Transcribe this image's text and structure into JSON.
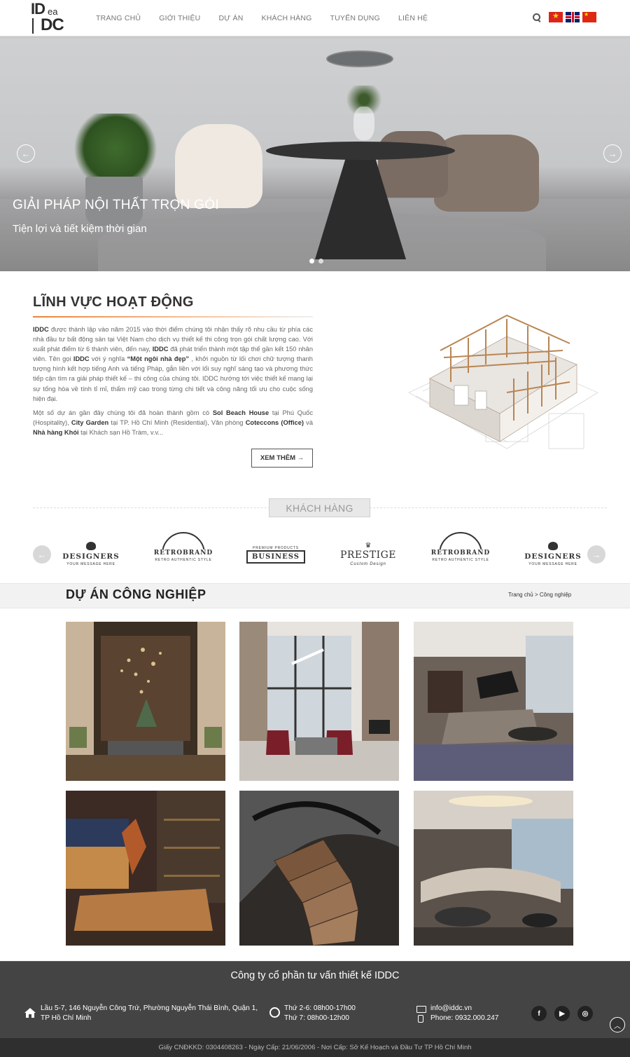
{
  "header": {
    "logo": {
      "line1": "ID",
      "line1_small": "ea",
      "line2": "DC"
    },
    "nav": [
      "TRANG CHỦ",
      "GIỚI THIỆU",
      "DỰ ÁN",
      "KHÁCH HÀNG",
      "TUYỂN DỤNG",
      "LIÊN HỆ"
    ],
    "icons": {
      "search": "search-icon"
    },
    "languages": [
      "vi",
      "en",
      "zh"
    ]
  },
  "hero": {
    "title": "GIẢI PHÁP NỘI THẤT TRỌN GÓI",
    "subtitle": "Tiện lợi và tiết kiệm thời gian",
    "slide_count": 2,
    "active_slide": 1
  },
  "field": {
    "title": "LĨNH VỰC HOẠT ĐỘNG",
    "p1": [
      {
        "t": "IDDC",
        "b": true
      },
      {
        "t": " được thành lập vào năm 2015 vào thời điểm chúng tôi nhận thấy rõ nhu cầu từ phía các nhà đầu tư bất động sản tại Việt Nam cho dịch vụ thiết kế thi công trọn gói chất lượng cao. Với xuất phát điểm từ 6 thành viên, đến nay, ",
        "b": false
      },
      {
        "t": "IDDC",
        "b": true
      },
      {
        "t": " đã phát triển thành một tập thể gần kết 150 nhân viên. Tên gọi ",
        "b": false
      },
      {
        "t": "IDDC",
        "b": true
      },
      {
        "t": " với ý nghĩa ",
        "b": false
      },
      {
        "t": "“Một ngôi nhà đẹp”",
        "b": true
      },
      {
        "t": " , khởi nguồn từ lối chơi chữ tượng thanh tượng hình kết hợp tiếng Anh và tiếng Pháp, gắn liền với lối suy nghĩ sáng tạo và phương thức tiếp cận tìm ra giải pháp thiết kế – thi công của chúng tôi. IDDC hướng tới việc thiết kế mang lại sự tổng hòa về tính tỉ mỉ, thẩm mỹ cao trong từng chi tiết và công năng tối ưu cho cuộc sống hiện đại.",
        "b": false
      }
    ],
    "p2": [
      {
        "t": "Một số dự án gần đây chúng tôi đã hoàn thành gồm có ",
        "b": false
      },
      {
        "t": "Sol Beach House",
        "b": true
      },
      {
        "t": " tại Phú Quốc (Hospitality), ",
        "b": false
      },
      {
        "t": "City Garden",
        "b": true
      },
      {
        "t": " tại TP. Hồ Chí Minh (Residential), Văn phòng ",
        "b": false
      },
      {
        "t": "Coteccons (Office)",
        "b": true
      },
      {
        "t": " và ",
        "b": false
      },
      {
        "t": "Nhà hàng Khói",
        "b": true
      },
      {
        "t": " tại Khách sạn Hồ Tràm, v.v...",
        "b": false
      }
    ],
    "more_label": "XEM THÊM →"
  },
  "customers": {
    "title": "KHÁCH HÀNG",
    "brands": [
      {
        "kind": "designers",
        "name": "DESIGNERS",
        "tag": "YOUR MESSAGE HERE"
      },
      {
        "kind": "retro",
        "name": "RETROBRAND",
        "tag": "RETRO AUTHENTIC STYLE"
      },
      {
        "kind": "business",
        "name": "BUSINESS",
        "tag": "PREMIUM PRODUCTS"
      },
      {
        "kind": "prestige",
        "name": "PRESTIGE",
        "tag": "Custom Design"
      },
      {
        "kind": "retro",
        "name": "RETROBRAND",
        "tag": "RETRO AUTHENTIC STYLE"
      },
      {
        "kind": "designers",
        "name": "DESIGNERS",
        "tag": "YOUR MESSAGE HERE"
      }
    ]
  },
  "projects": {
    "title": "DỰ ÁN CÔNG NGHIỆP",
    "breadcrumb": "Trang chủ > Công nghiệp",
    "images": [
      "lobby-chandelier",
      "living-room-window",
      "living-room-piano",
      "bedroom-sculpture",
      "spiral-staircase",
      "round-sofa-lounge"
    ]
  },
  "footer": {
    "company": "Công ty cổ phần tư vấn thiết kế IDDC",
    "address_line1": "Lầu 5-7, 146 Nguyễn Công Trứ, Phường Nguyễn Thái Bình, Quận 1,",
    "address_line2": "TP Hồ Chí Minh",
    "hours_line1": "Thứ 2-6: 08h00-17h00",
    "hours_line2": "Thứ 7: 08h00-12h00",
    "email": "info@iddc.vn",
    "phone": "Phone: 0932.000.247",
    "social": [
      "facebook-icon",
      "youtube-icon",
      "instagram-icon"
    ],
    "license": "Giấy CNĐKKD: 0304408263 - Ngày Cấp: 21/06/2006 - Nơi Cấp: Sở Kế Hoạch và Đầu Tư TP Hồ Chí Minh"
  }
}
